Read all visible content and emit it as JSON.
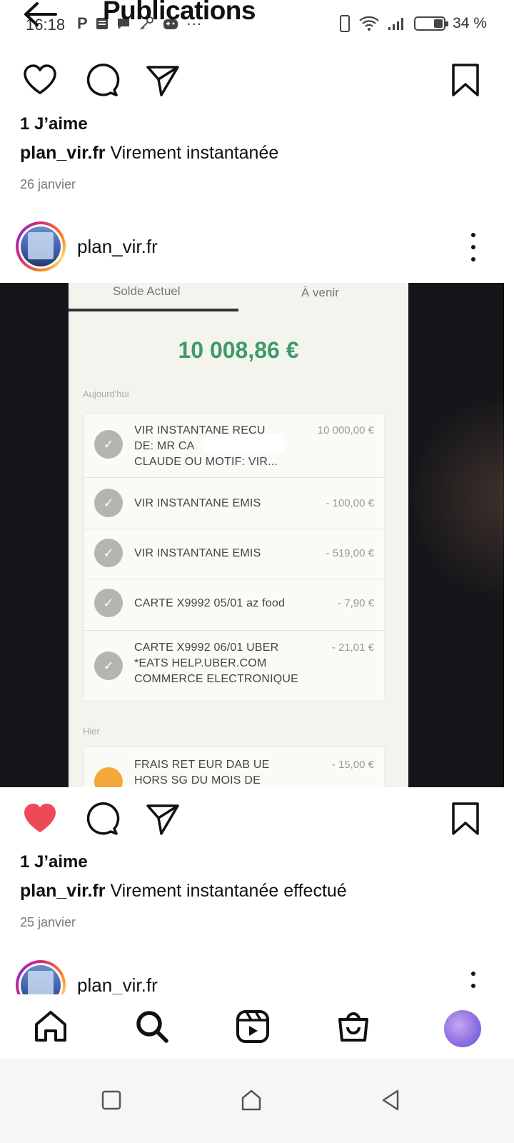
{
  "status_bar": {
    "time": "16:18",
    "notification_icons": [
      "parking-icon",
      "message-icon",
      "chat-icon",
      "key-icon",
      "gamepad-icon"
    ],
    "overflow": "···",
    "battery_percent": "34 %",
    "battery_level": 0.34
  },
  "header": {
    "title": "Publications"
  },
  "post1": {
    "likes": "1 J’aime",
    "username": "plan_vir.fr",
    "caption": "Virement instantanée",
    "date": "26 janvier",
    "liked": false
  },
  "post2": {
    "username": "plan_vir.fr",
    "likes": "1 J’aime",
    "caption": "Virement instantanée effectué",
    "date": "25 janvier",
    "liked": true,
    "image": {
      "tab_current": "Solde Actuel",
      "tab_upcoming": "À venir",
      "balance": "10 008,86 €",
      "section_today": "Aujourd'hui",
      "section_yesterday": "Hier",
      "transactions": [
        {
          "lines": [
            "VIR INSTANTANE RECU",
            "DE: MR CA",
            "CLAUDE OU MOTIF: VIR..."
          ],
          "amount": "10 000,00 €"
        },
        {
          "lines": [
            "VIR INSTANTANE EMIS"
          ],
          "amount": "- 100,00 €"
        },
        {
          "lines": [
            "VIR INSTANTANE EMIS"
          ],
          "amount": "- 519,00 €"
        },
        {
          "lines": [
            "CARTE X9992 05/01 az food"
          ],
          "amount": "- 7,90 €"
        },
        {
          "lines": [
            "CARTE X9992 06/01 UBER",
            "*EATS HELP.UBER.COM",
            "COMMERCE ELECTRONIQUE"
          ],
          "amount": "- 21,01 €"
        }
      ],
      "yesterday_transaction": {
        "lines": [
          "FRAIS RET EUR DAB UE",
          "HORS SG DU MOIS DE"
        ],
        "amount": "- 15,00 €"
      }
    }
  },
  "post3": {
    "username": "plan_vir.fr"
  },
  "bottom_nav": [
    "home-icon",
    "search-icon",
    "reels-icon",
    "shop-icon",
    "profile-avatar"
  ],
  "colors": {
    "like_red": "#ed4956",
    "balance_green": "#3f9a6a"
  }
}
